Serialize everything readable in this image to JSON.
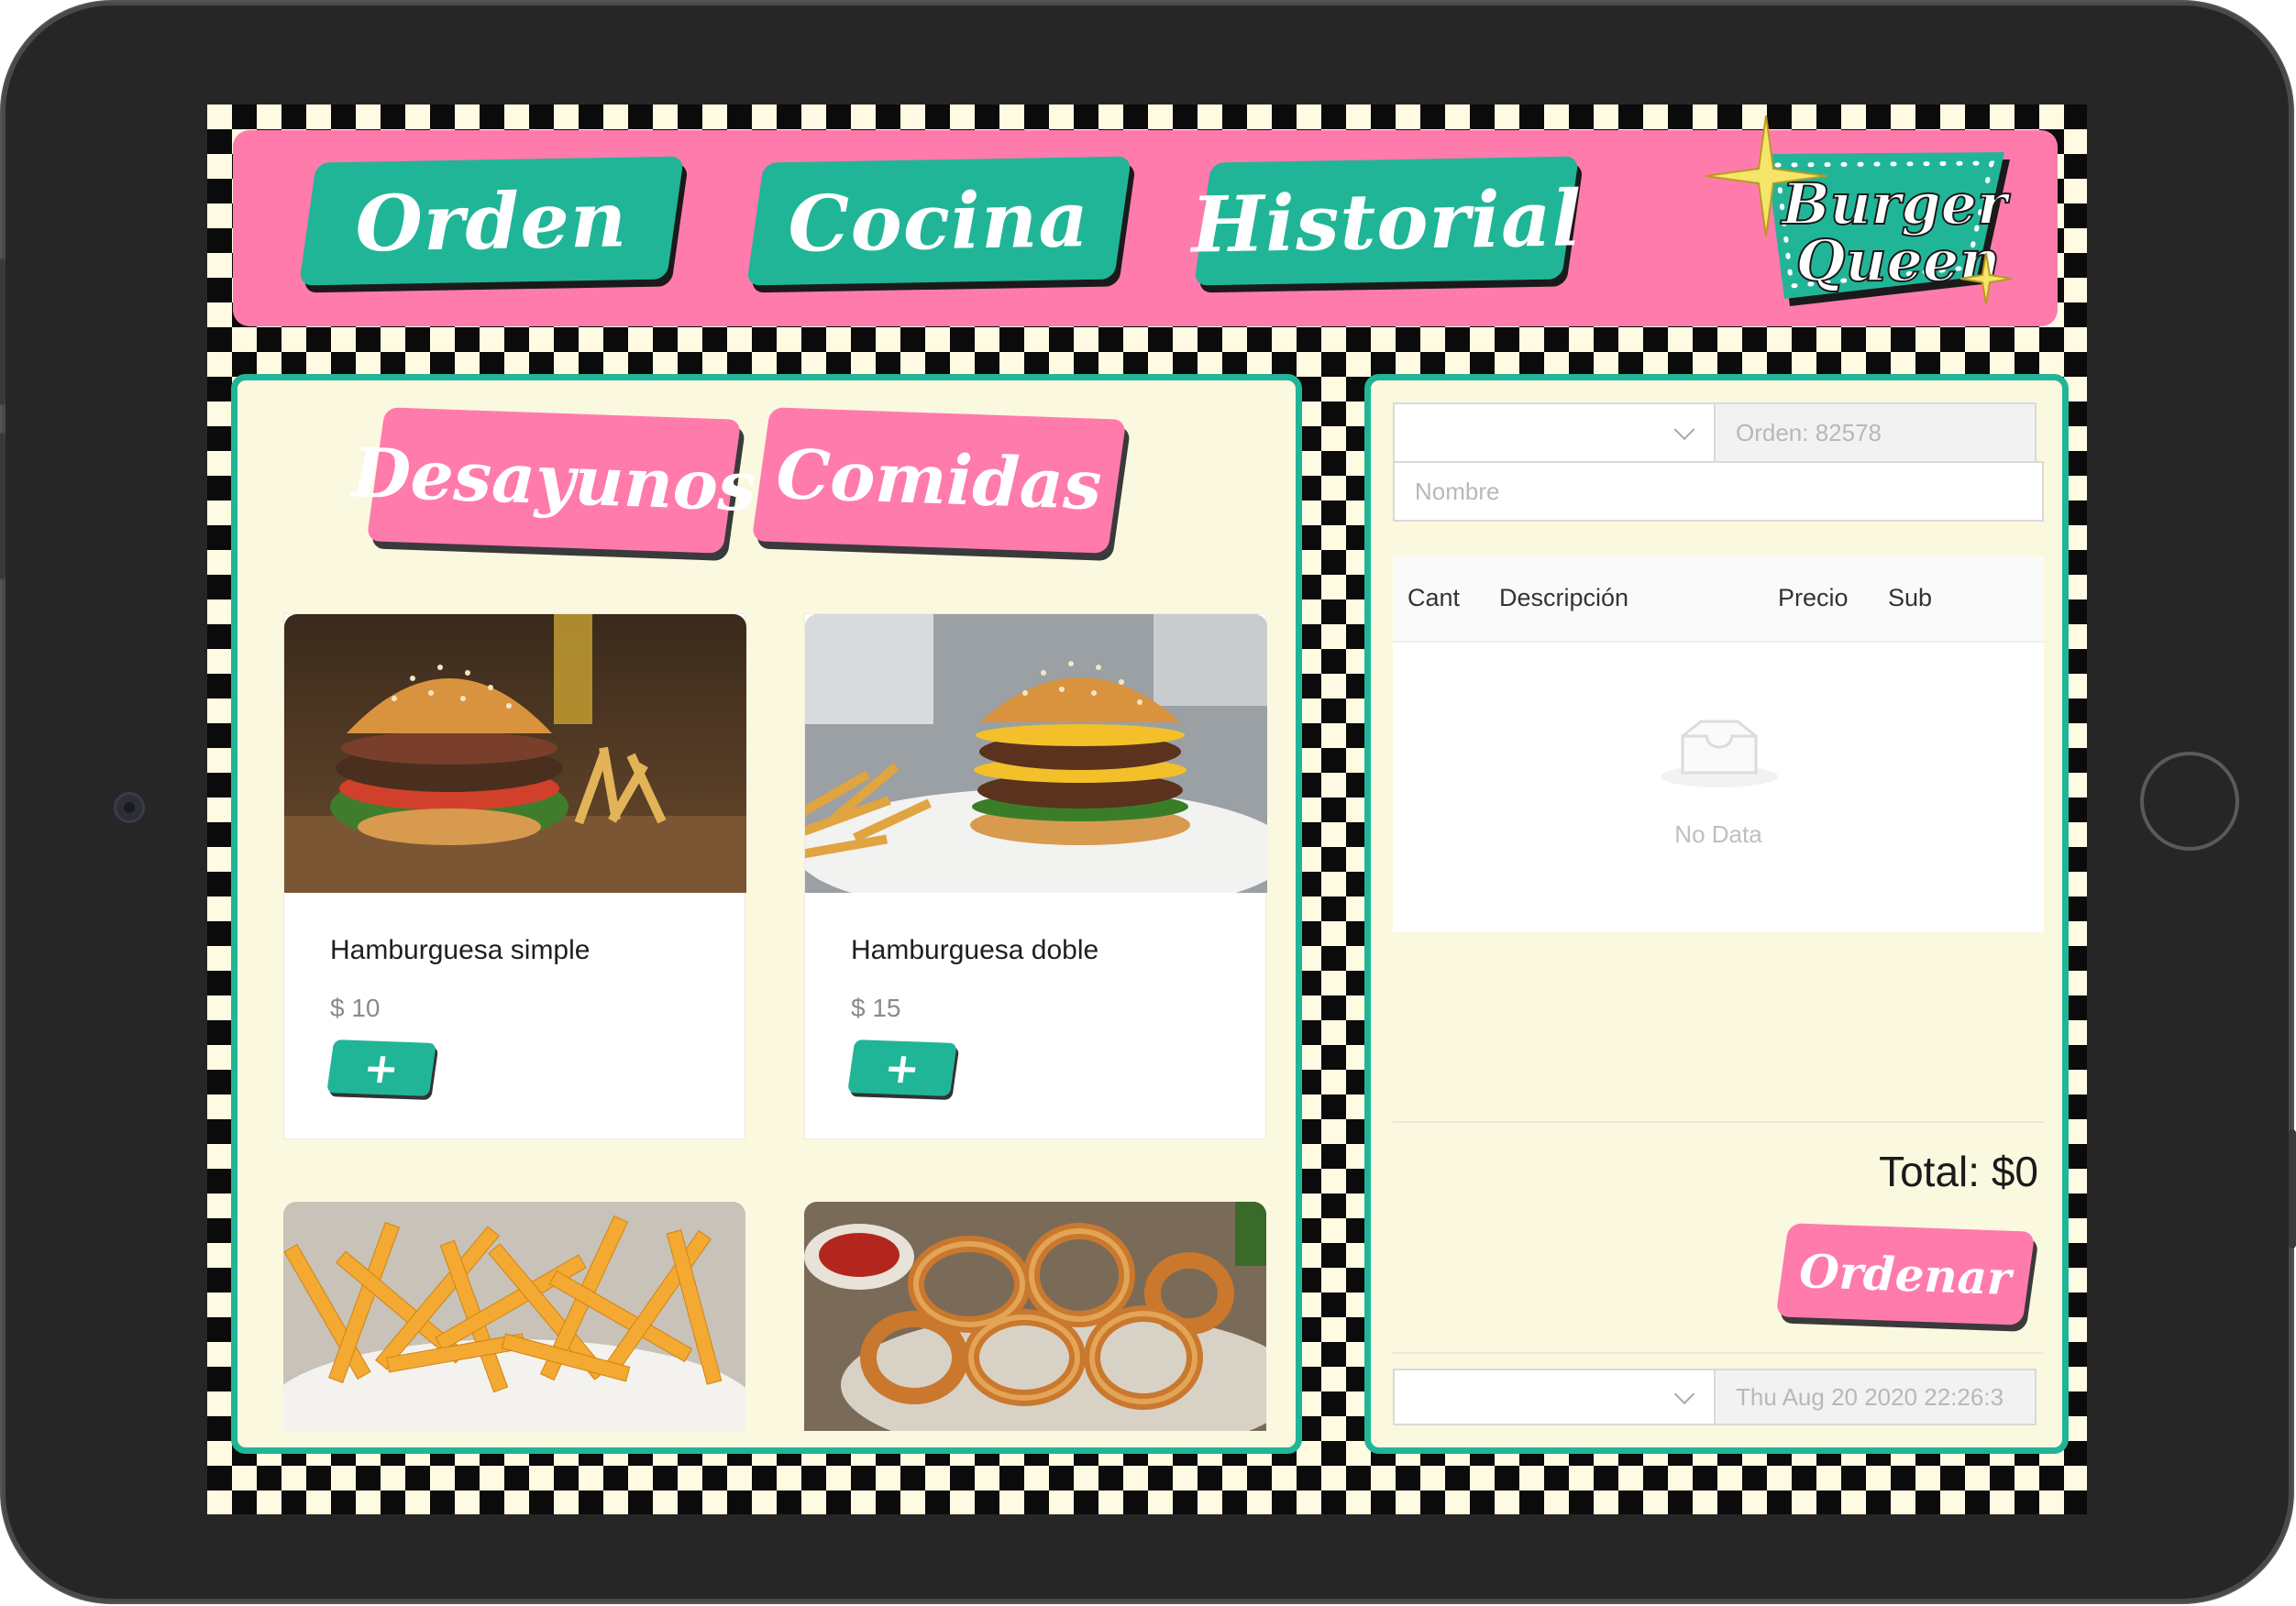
{
  "nav": {
    "orden_label": "Orden",
    "cocina_label": "Cocina",
    "historial_label": "Historial",
    "brand_line1": "Burger",
    "brand_line2": "Queen"
  },
  "categories": {
    "desayunos_label": "Desayunos",
    "comidas_label": "Comidas"
  },
  "products": [
    {
      "name": "Hamburguesa simple",
      "price": "$ 10",
      "add_label": "+"
    },
    {
      "name": "Hamburguesa doble",
      "price": "$ 15",
      "add_label": "+"
    }
  ],
  "order": {
    "order_number": "Orden: 82578",
    "name_placeholder": "Nombre",
    "columns": [
      "Cant",
      "Descripción",
      "Precio",
      "Sub"
    ],
    "empty_text": "No Data",
    "total_label": "Total:",
    "total_value": "$0",
    "submit_label": "Ordenar",
    "date_value": "Thu Aug 20 2020 22:26:3"
  },
  "colors": {
    "accent_teal": "#21b597",
    "accent_pink": "#ff7bac",
    "panel_cream": "#fbf8e0"
  }
}
